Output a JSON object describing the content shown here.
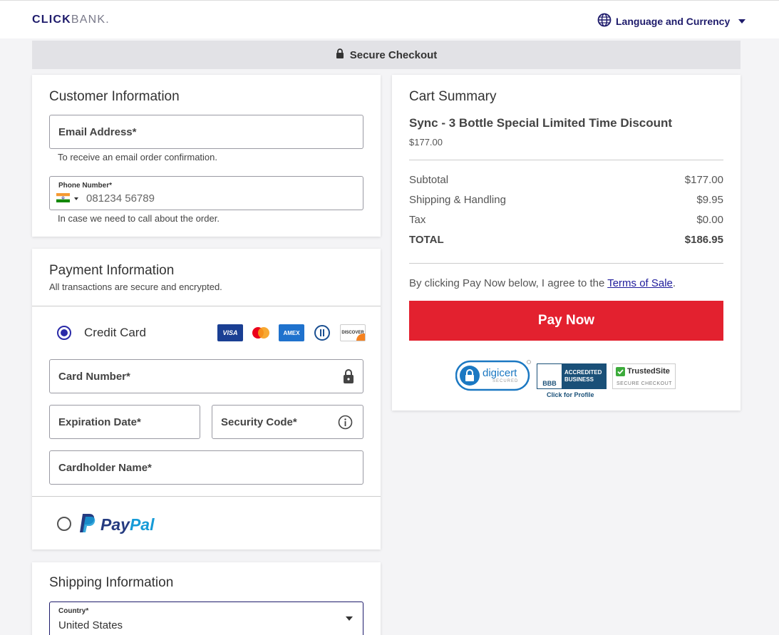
{
  "header": {
    "logo_click": "CLICK",
    "logo_bank": "BANK.",
    "language_label": "Language and Currency"
  },
  "secure_bar": {
    "label": "Secure Checkout"
  },
  "customer": {
    "title": "Customer Information",
    "email_label": "Email Address*",
    "email_helper": "To receive an email order confirmation.",
    "phone_label": "Phone Number*",
    "phone_placeholder": "081234 56789",
    "phone_helper": "In case we need to call about the order."
  },
  "payment": {
    "title": "Payment Information",
    "subtitle": "All transactions are secure and encrypted.",
    "credit_card_label": "Credit Card",
    "card_brands": [
      "VISA",
      "mastercard",
      "AMEX",
      "diners",
      "DISCOVER"
    ],
    "card_number_label": "Card Number*",
    "expiration_label": "Expiration Date*",
    "security_code_label": "Security Code*",
    "cardholder_label": "Cardholder Name*",
    "paypal_pay": "Pay",
    "paypal_pal": "Pal"
  },
  "shipping": {
    "title": "Shipping Information",
    "country_label": "Country*",
    "country_value": "United States"
  },
  "cart": {
    "title": "Cart Summary",
    "product_name": "Sync - 3 Bottle Special Limited Time Discount",
    "product_price": "$177.00",
    "rows": [
      {
        "label": "Subtotal",
        "value": "$177.00"
      },
      {
        "label": "Shipping & Handling",
        "value": "$9.95"
      },
      {
        "label": "Tax",
        "value": "$0.00"
      },
      {
        "label": "TOTAL",
        "value": "$186.95"
      }
    ],
    "terms_prefix": "By clicking Pay Now below, I agree to the ",
    "terms_link": "Terms of Sale",
    "terms_suffix": ".",
    "pay_button": "Pay Now"
  },
  "badges": {
    "digicert": "digicert",
    "digicert_sub": "SECURED",
    "bbb_line1": "ACCREDITED",
    "bbb_line2": "BUSINESS",
    "bbb_mark": "BBB",
    "bbb_profile": "Click for Profile",
    "trustedsite": "TrustedSite",
    "trustedsite_sub": "SECURE CHECKOUT"
  },
  "colors": {
    "brand": "#1e1b6b",
    "pay_button": "#e3212f",
    "radio_selected": "#2a2aa8"
  }
}
